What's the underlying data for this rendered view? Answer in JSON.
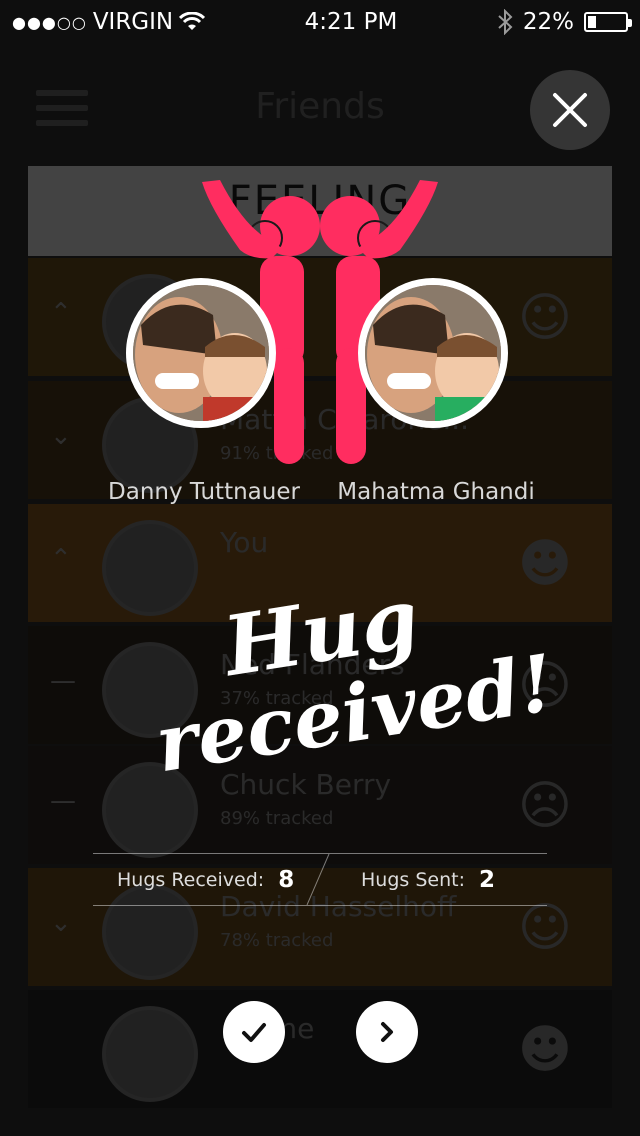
{
  "status_bar": {
    "carrier": "VIRGIN",
    "signal_dots": "●●●○○",
    "time": "4:21 PM",
    "battery_percent": "22%",
    "battery_level": 0.22
  },
  "background": {
    "title": "Friends",
    "feeling_label": "FEELING",
    "rows": [
      {
        "name": "",
        "tracked": "",
        "face": "☺",
        "color": "#3a2a10"
      },
      {
        "name": "Mattia Chiarone...",
        "tracked": "91% tracked",
        "face": "",
        "color": "#2b1f10"
      },
      {
        "name": "You",
        "tracked": "",
        "face": "☻",
        "color": "#4a3112"
      },
      {
        "name": "Ned Flanders",
        "tracked": "37% tracked",
        "face": "☹",
        "color": "#1b1612"
      },
      {
        "name": "Chuck Berry",
        "tracked": "89% tracked",
        "face": "☹",
        "color": "#1a1714"
      },
      {
        "name": "David Hasselhoff",
        "tracked": "78% tracked",
        "face": "☺",
        "color": "#3a2810"
      },
      {
        "name": "...ilone",
        "tracked": "",
        "face": "☻",
        "color": "#141414"
      }
    ]
  },
  "hug": {
    "sender_name": "Danny Tuttnauer",
    "receiver_name": "Mahatma Ghandi",
    "title_line1": "Hug",
    "title_line2": "received!",
    "accent_color": "#ff2d60"
  },
  "stats": {
    "received_label": "Hugs Received:",
    "received_value": "8",
    "sent_label": "Hugs Sent:",
    "sent_value": "2"
  },
  "icons": {
    "close": "close-icon",
    "confirm": "checkmark-icon",
    "next": "chevron-right-icon"
  }
}
